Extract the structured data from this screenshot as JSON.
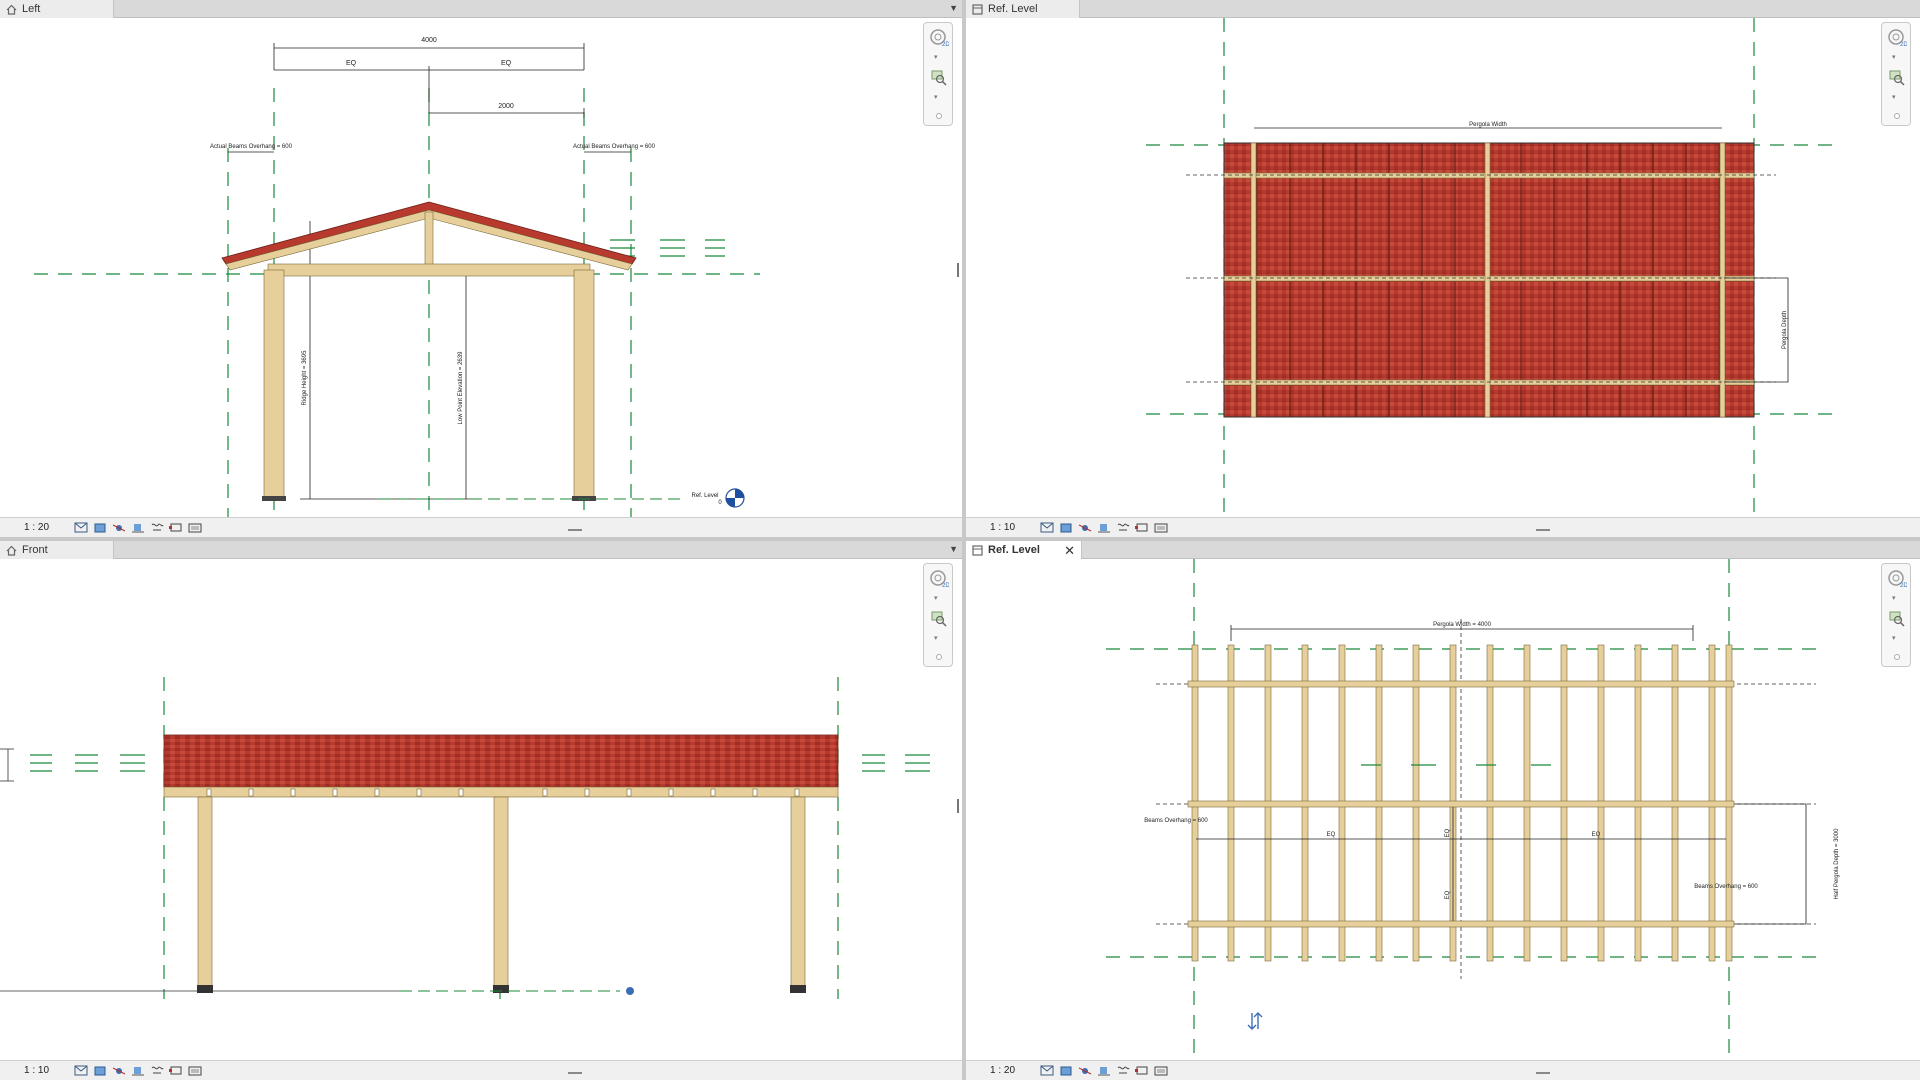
{
  "views": [
    {
      "tab_title": "Left",
      "tab_icon": "elevation-view-icon",
      "scale": "1 : 20",
      "annotations": {
        "overall_width": "4000",
        "eq_left": "EQ",
        "eq_right": "EQ",
        "half_width": "2000",
        "overhang_left": "Actual Beams Overhang = 600",
        "overhang_right": "Actual Beams Overhang = 600",
        "ridge_height": "Ridge Height = 3695",
        "low_point": "Low Point Elevation = 2639",
        "level_name": "Ref. Level",
        "level_value": "0"
      }
    },
    {
      "tab_title": "Ref. Level",
      "tab_icon": "plan-view-icon",
      "scale": "1 : 10",
      "annotations": {
        "top_dim": "Pergola Width",
        "side_dim": "Pergola Depth"
      }
    },
    {
      "tab_title": "Front",
      "tab_icon": "elevation-view-icon",
      "scale": "1 : 10"
    },
    {
      "tab_title": "Ref. Level",
      "tab_icon": "plan-view-icon",
      "scale": "1 : 20",
      "close_glyph": "✕",
      "annotations": {
        "top_dim": "Pergola Width = 4000",
        "eq_a": "EQ",
        "eq_b": "EQ",
        "eq_c": "EQ",
        "eq_d": "EQ",
        "beam_overhang_left": "Beams Overhang = 600",
        "beam_overhang_right": "Beams Overhang = 600",
        "side_dim": "Half Pergola Depth = 3000"
      }
    }
  ],
  "colors": {
    "grid": "#1a8a3a",
    "timber": "#e6cf9a",
    "timber_edge": "#7a6a3a",
    "roof": "#b8392e",
    "roof_dark": "#8c2a22",
    "pane_bg": "#ffffff"
  }
}
